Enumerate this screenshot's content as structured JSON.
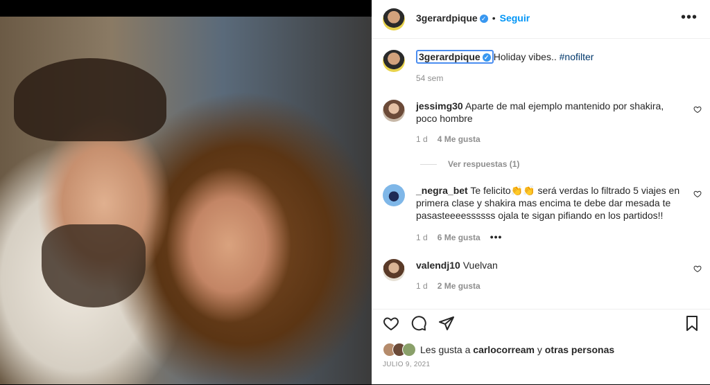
{
  "post": {
    "author": "3gerardpique",
    "follow_label": "Seguir",
    "separator": "•",
    "more_label": "•••",
    "verified_mark": "✓",
    "caption_text": "Holiday vibes.. ",
    "caption_hashtag": "#nofilter",
    "caption_age": "54 sem"
  },
  "comments": [
    {
      "user": "jessimg30",
      "text": "Aparte de mal ejemplo mantenido por shakira, poco hombre",
      "age": "1 d",
      "likes": "4 Me gusta",
      "replies": "Ver respuestas (1)"
    },
    {
      "user": "_negra_bet",
      "text": "Te felicito👏👏 será verdas lo filtrado 5 viajes en primera clase y shakira mas encima te debe dar mesada te pasasteeeessssss ojala te sigan pifiando en los partidos!!",
      "age": "1 d",
      "likes": "6 Me gusta",
      "more": "•••"
    },
    {
      "user": "valendj10",
      "text": "Vuelvan",
      "age": "1 d",
      "likes": "2 Me gusta"
    }
  ],
  "likes": {
    "prefix": "Les gusta a ",
    "user": "carlocorream",
    "middle": " y ",
    "others": "otras personas"
  },
  "date": "JULIO 9, 2021",
  "colors": {
    "accent": "#0095f6",
    "verified": "#3897f0",
    "hashtag": "#00376b"
  }
}
